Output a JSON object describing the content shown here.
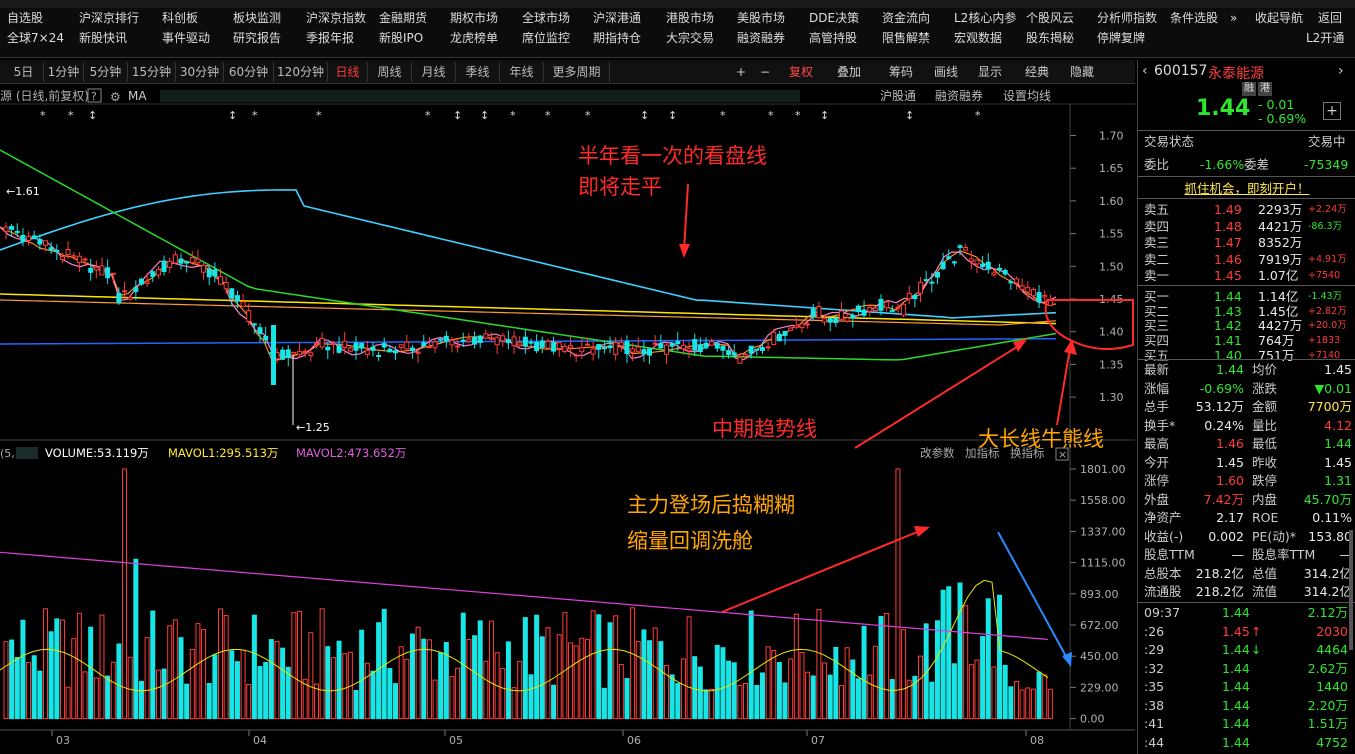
{
  "menu": {
    "row1": [
      "自选股",
      "沪深京排行",
      "科创板",
      "板块监测",
      "沪深京指数",
      "金融期货",
      "期权市场",
      "全球市场",
      "沪深港通",
      "港股市场",
      "美股市场",
      "DDE决策",
      "资金流向",
      "L2核心内参",
      "个股风云",
      "分析师指数",
      "条件选股",
      "»",
      "收起导航",
      "返回"
    ],
    "row2": [
      "全球7×24",
      "新股快讯",
      "事件驱动",
      "研究报告",
      "季报年报",
      "新股IPO",
      "龙虎榜单",
      "席位监控",
      "期指持仓",
      "大宗交易",
      "融资融券",
      "高管持股",
      "限售解禁",
      "宏观数据",
      "股东揭秘",
      "停牌复牌",
      "L2开通"
    ]
  },
  "toolbar": {
    "periods": [
      "5日",
      "1分钟",
      "5分钟",
      "15分钟",
      "30分钟",
      "60分钟",
      "120分钟",
      "日线",
      "周线",
      "月线",
      "季线",
      "年线",
      "更多周期"
    ],
    "active_period": "日线",
    "controls": [
      "+",
      "−",
      "复权",
      "叠加",
      "筹码",
      "画线",
      "显示",
      "经典",
      "隐藏"
    ],
    "chart_title": "源 (日线,前复权)",
    "chart_links": [
      "沪股通",
      "融资融券",
      "设置均线"
    ],
    "ma_label": "MA"
  },
  "chart": {
    "price_ticks": [
      "1.70",
      "1.65",
      "1.60",
      "1.55",
      "1.50",
      "1.45",
      "1.40",
      "1.35",
      "1.30"
    ],
    "vol_ticks": [
      "1801.00",
      "1558.00",
      "1337.00",
      "1115.00",
      "893.00",
      "672.00",
      "450.00",
      "229.00",
      "0.00"
    ],
    "x_labels": [
      "03",
      "04",
      "05",
      "06",
      "07",
      "08"
    ],
    "high_label": "←1.61",
    "low_label": "←1.25",
    "vol_legend": {
      "prefix": "(5,",
      "volume": "VOLUME:53.119万",
      "mavol1": "MAVOL1:295.513万",
      "mavol2": "MAVOL2:473.652万"
    },
    "vol_links": [
      "改参数",
      "加指标",
      "换指标"
    ]
  },
  "annotations": {
    "a1_line1": "半年看一次的看盘线",
    "a1_line2": "即将走平",
    "a2": "中期趋势线",
    "a3": "大长线牛熊线",
    "a4_line1": "主力登场后捣糊糊",
    "a4_line2": "缩量回调洗舱"
  },
  "colors": {
    "up": "#ff3c3c",
    "down": "#18e6e6",
    "ma5": "#ff7ec8",
    "ma10": "#ff8c1a",
    "ma20": "#ffe600",
    "ma60": "#2bd92b",
    "ma120": "#3fd0ff",
    "ma250": "#2266ff",
    "mavol1": "#e6e600",
    "mavol2": "#e040e0"
  },
  "stock": {
    "code": "600157",
    "name": "永泰能源",
    "tag1": "融",
    "tag2": "港",
    "price": "1.44",
    "change": "- 0.01",
    "pct": "- 0.69%",
    "status_label": "交易状态",
    "status": "交易中",
    "weibi_label": "委比",
    "weibi": "-1.66%",
    "weicha_label": "委差",
    "weicha": "-75349",
    "promo": "抓住机会，即刻开户！"
  },
  "asks": [
    {
      "label": "卖五",
      "price": "1.49",
      "vol": "2293万",
      "chg": "+2.24万"
    },
    {
      "label": "卖四",
      "price": "1.48",
      "vol": "4421万",
      "chg": "-86.3万"
    },
    {
      "label": "卖三",
      "price": "1.47",
      "vol": "8352万",
      "chg": ""
    },
    {
      "label": "卖二",
      "price": "1.46",
      "vol": "7919万",
      "chg": "+4.91万"
    },
    {
      "label": "卖一",
      "price": "1.45",
      "vol": "1.07亿",
      "chg": "+7540"
    }
  ],
  "bids": [
    {
      "label": "买一",
      "price": "1.44",
      "vol": "1.14亿",
      "chg": "-1.43万"
    },
    {
      "label": "买二",
      "price": "1.43",
      "vol": "1.45亿",
      "chg": "+2.82万"
    },
    {
      "label": "买三",
      "price": "1.42",
      "vol": "4427万",
      "chg": "+20.0万"
    },
    {
      "label": "买四",
      "price": "1.41",
      "vol": "764万",
      "chg": "+1833"
    },
    {
      "label": "买五",
      "price": "1.40",
      "vol": "751万",
      "chg": "+7140"
    }
  ],
  "stats": [
    {
      "l1": "最新",
      "v1": "1.44",
      "c1": "green",
      "l2": "均价",
      "v2": "1.45",
      "c2": "wht"
    },
    {
      "l1": "涨幅",
      "v1": "-0.69%",
      "c1": "green",
      "l2": "涨跌",
      "v2": "▼0.01",
      "c2": "green"
    },
    {
      "l1": "总手",
      "v1": "53.12万",
      "c1": "wht",
      "l2": "金额",
      "v2": "7700万",
      "c2": "yel"
    },
    {
      "l1": "换手*",
      "v1": "0.24%",
      "c1": "wht",
      "l2": "量比",
      "v2": "4.12",
      "c2": "red"
    },
    {
      "l1": "最高",
      "v1": "1.46",
      "c1": "red",
      "l2": "最低",
      "v2": "1.44",
      "c2": "green"
    },
    {
      "l1": "今开",
      "v1": "1.45",
      "c1": "wht",
      "l2": "昨收",
      "v2": "1.45",
      "c2": "wht"
    },
    {
      "l1": "涨停",
      "v1": "1.60",
      "c1": "red",
      "l2": "跌停",
      "v2": "1.31",
      "c2": "green"
    },
    {
      "l1": "外盘",
      "v1": "7.42万",
      "c1": "red",
      "l2": "内盘",
      "v2": "45.70万",
      "c2": "green"
    },
    {
      "l1": "净资产",
      "v1": "2.17",
      "c1": "wht",
      "l2": "ROE",
      "v2": "0.11%",
      "c2": "wht"
    },
    {
      "l1": "收益(-)",
      "v1": "0.002",
      "c1": "wht",
      "l2": "PE(动)*",
      "v2": "153.80",
      "c2": "wht"
    },
    {
      "l1": "股息TTM",
      "v1": "—",
      "c1": "wht",
      "l2": "股息率TTM",
      "v2": "—",
      "c2": "wht"
    },
    {
      "l1": "总股本",
      "v1": "218.2亿",
      "c1": "wht",
      "l2": "总值",
      "v2": "314.2亿",
      "c2": "wht"
    },
    {
      "l1": "流通股",
      "v1": "218.2亿",
      "c1": "wht",
      "l2": "流值",
      "v2": "314.2亿",
      "c2": "wht"
    }
  ],
  "ticks": [
    {
      "time": "09:37",
      "price": "1.44",
      "vol": "2.12万",
      "c": "green",
      "arrow": ""
    },
    {
      "time": ":26",
      "price": "1.45",
      "vol": "2030",
      "c": "red",
      "arrow": "↑"
    },
    {
      "time": ":29",
      "price": "1.44",
      "vol": "4464",
      "c": "green",
      "arrow": "↓"
    },
    {
      "time": ":32",
      "price": "1.44",
      "vol": "2.62万",
      "c": "green",
      "arrow": ""
    },
    {
      "time": ":35",
      "price": "1.44",
      "vol": "1440",
      "c": "green",
      "arrow": ""
    },
    {
      "time": ":38",
      "price": "1.44",
      "vol": "2.20万",
      "c": "green",
      "arrow": ""
    },
    {
      "time": ":41",
      "price": "1.44",
      "vol": "1.51万",
      "c": "green",
      "arrow": ""
    },
    {
      "time": ":44",
      "price": "1.44",
      "vol": "4752",
      "c": "green",
      "arrow": ""
    }
  ]
}
